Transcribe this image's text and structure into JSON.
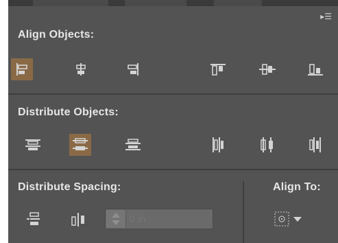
{
  "panel": {
    "menu_icon": "flyout-menu-icon",
    "align_objects": {
      "label": "Align Objects:",
      "buttons": [
        {
          "name": "horizontal-align-left",
          "icon": "horizontal-align-left-icon",
          "selected": true
        },
        {
          "name": "horizontal-align-center",
          "icon": "horizontal-align-center-icon",
          "selected": false
        },
        {
          "name": "horizontal-align-right",
          "icon": "horizontal-align-right-icon",
          "selected": false
        },
        {
          "name": "vertical-align-top",
          "icon": "vertical-align-top-icon",
          "selected": false
        },
        {
          "name": "vertical-align-center",
          "icon": "vertical-align-center-icon",
          "selected": false
        },
        {
          "name": "vertical-align-bottom",
          "icon": "vertical-align-bottom-icon",
          "selected": false
        }
      ]
    },
    "distribute_objects": {
      "label": "Distribute Objects:",
      "buttons": [
        {
          "name": "vertical-distribute-top",
          "icon": "vertical-distribute-top-icon",
          "selected": false
        },
        {
          "name": "vertical-distribute-center",
          "icon": "vertical-distribute-center-icon",
          "selected": true
        },
        {
          "name": "vertical-distribute-bottom",
          "icon": "vertical-distribute-bottom-icon",
          "selected": false
        },
        {
          "name": "horizontal-distribute-left",
          "icon": "horizontal-distribute-left-icon",
          "selected": false
        },
        {
          "name": "horizontal-distribute-center",
          "icon": "horizontal-distribute-center-icon",
          "selected": false
        },
        {
          "name": "horizontal-distribute-right",
          "icon": "horizontal-distribute-right-icon",
          "selected": false
        }
      ]
    },
    "distribute_spacing": {
      "label": "Distribute Spacing:",
      "vertical_icon": "vertical-distribute-space-icon",
      "horizontal_icon": "horizontal-distribute-space-icon",
      "value_placeholder": "0 in"
    },
    "align_to": {
      "label": "Align To:",
      "icon": "align-to-selection-icon",
      "dropdown_icon": "chevron-down-icon"
    }
  },
  "colors": {
    "panel_bg": "#535353",
    "selected_bg": "#8a6a46",
    "label_text": "#e6e6e6",
    "icon": "#d4d4d4"
  }
}
